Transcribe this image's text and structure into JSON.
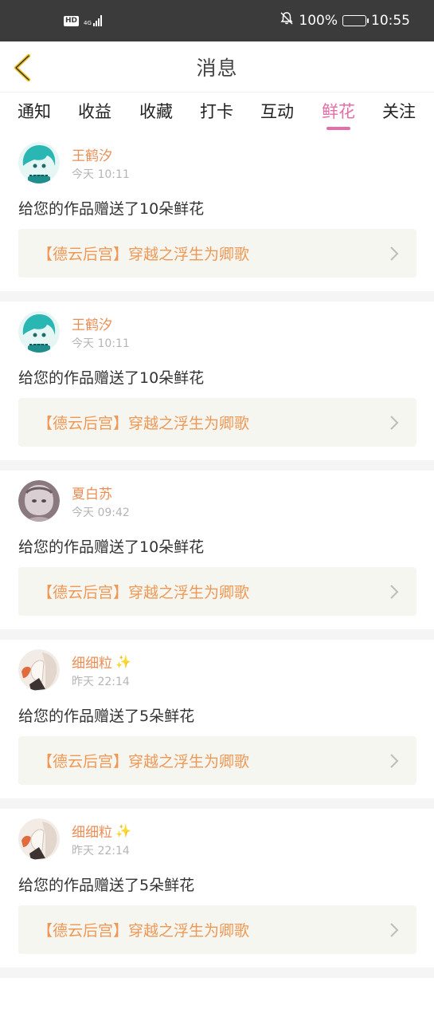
{
  "status_bar": {
    "hd": "HD",
    "network_type": "4G",
    "battery": "100%",
    "time": "10:55"
  },
  "header": {
    "title": "消息"
  },
  "tabs": [
    {
      "label": "通知",
      "active": false
    },
    {
      "label": "收益",
      "active": false
    },
    {
      "label": "收藏",
      "active": false
    },
    {
      "label": "打卡",
      "active": false
    },
    {
      "label": "互动",
      "active": false
    },
    {
      "label": "鲜花",
      "active": true
    },
    {
      "label": "关注",
      "active": false
    }
  ],
  "colors": {
    "accent": "#e46fa8",
    "name": "#ea8e55",
    "link": "#ef9855",
    "status_bar": "#3b3b3b"
  },
  "messages": [
    {
      "user": "王鹤汐",
      "badge": false,
      "time": "今天 10:11",
      "text": "给您的作品赠送了10朵鲜花",
      "work": "【德云后宫】穿越之浮生为卿歌"
    },
    {
      "user": "王鹤汐",
      "badge": false,
      "time": "今天 10:11",
      "text": "给您的作品赠送了10朵鲜花",
      "work": "【德云后宫】穿越之浮生为卿歌"
    },
    {
      "user": "夏白苏",
      "badge": false,
      "time": "今天 09:42",
      "text": "给您的作品赠送了10朵鲜花",
      "work": "【德云后宫】穿越之浮生为卿歌"
    },
    {
      "user": "细细粒",
      "badge": true,
      "time": "昨天 22:14",
      "text": "给您的作品赠送了5朵鲜花",
      "work": "【德云后宫】穿越之浮生为卿歌"
    },
    {
      "user": "细细粒",
      "badge": true,
      "time": "昨天 22:14",
      "text": "给您的作品赠送了5朵鲜花",
      "work": "【德云后宫】穿越之浮生为卿歌"
    }
  ],
  "icons": {
    "back": "chevron-left-icon",
    "work_link": "chevron-right-icon",
    "badge": "sparkle-icon",
    "mute": "bell-off-icon",
    "battery": "battery-charging-icon"
  }
}
